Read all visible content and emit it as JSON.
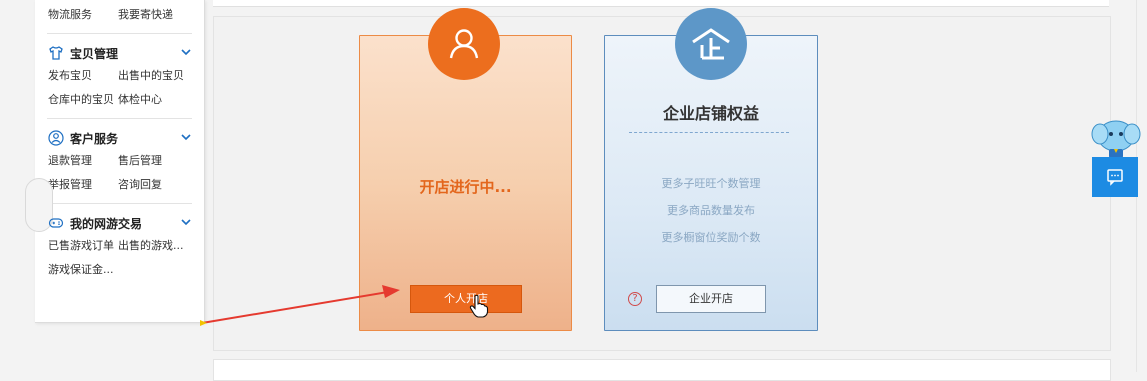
{
  "sidebar": {
    "top_links": [
      "物流服务",
      "我要寄快递"
    ],
    "sections": [
      {
        "title": "宝贝管理",
        "icon": "tshirt-icon",
        "links": [
          "发布宝贝",
          "出售中的宝贝",
          "仓库中的宝贝",
          "体检中心"
        ]
      },
      {
        "title": "客户服务",
        "icon": "user-circle-icon",
        "links": [
          "退款管理",
          "售后管理",
          "举报管理",
          "咨询回复"
        ]
      },
      {
        "title": "我的网游交易",
        "icon": "gamepad-icon",
        "links": [
          "已售游戏订单",
          "出售的游戏...",
          "游戏保证金..."
        ]
      }
    ]
  },
  "personal_card": {
    "status": "开店进行中...",
    "button_label": "个人开店",
    "border_color": "#ec8b46"
  },
  "enterprise_card": {
    "title": "企业店铺权益",
    "icon_text": "企",
    "benefits": [
      "更多子旺旺个数管理",
      "更多商品数量发布",
      "更多橱窗位奖励个数"
    ],
    "help_icon": "?",
    "button_label": "企业开店",
    "border_color": "#5d8dbd"
  },
  "colors": {
    "orange": "#ec6e1e",
    "blue": "#5d97c8",
    "chat_blue": "#1d8be3"
  }
}
